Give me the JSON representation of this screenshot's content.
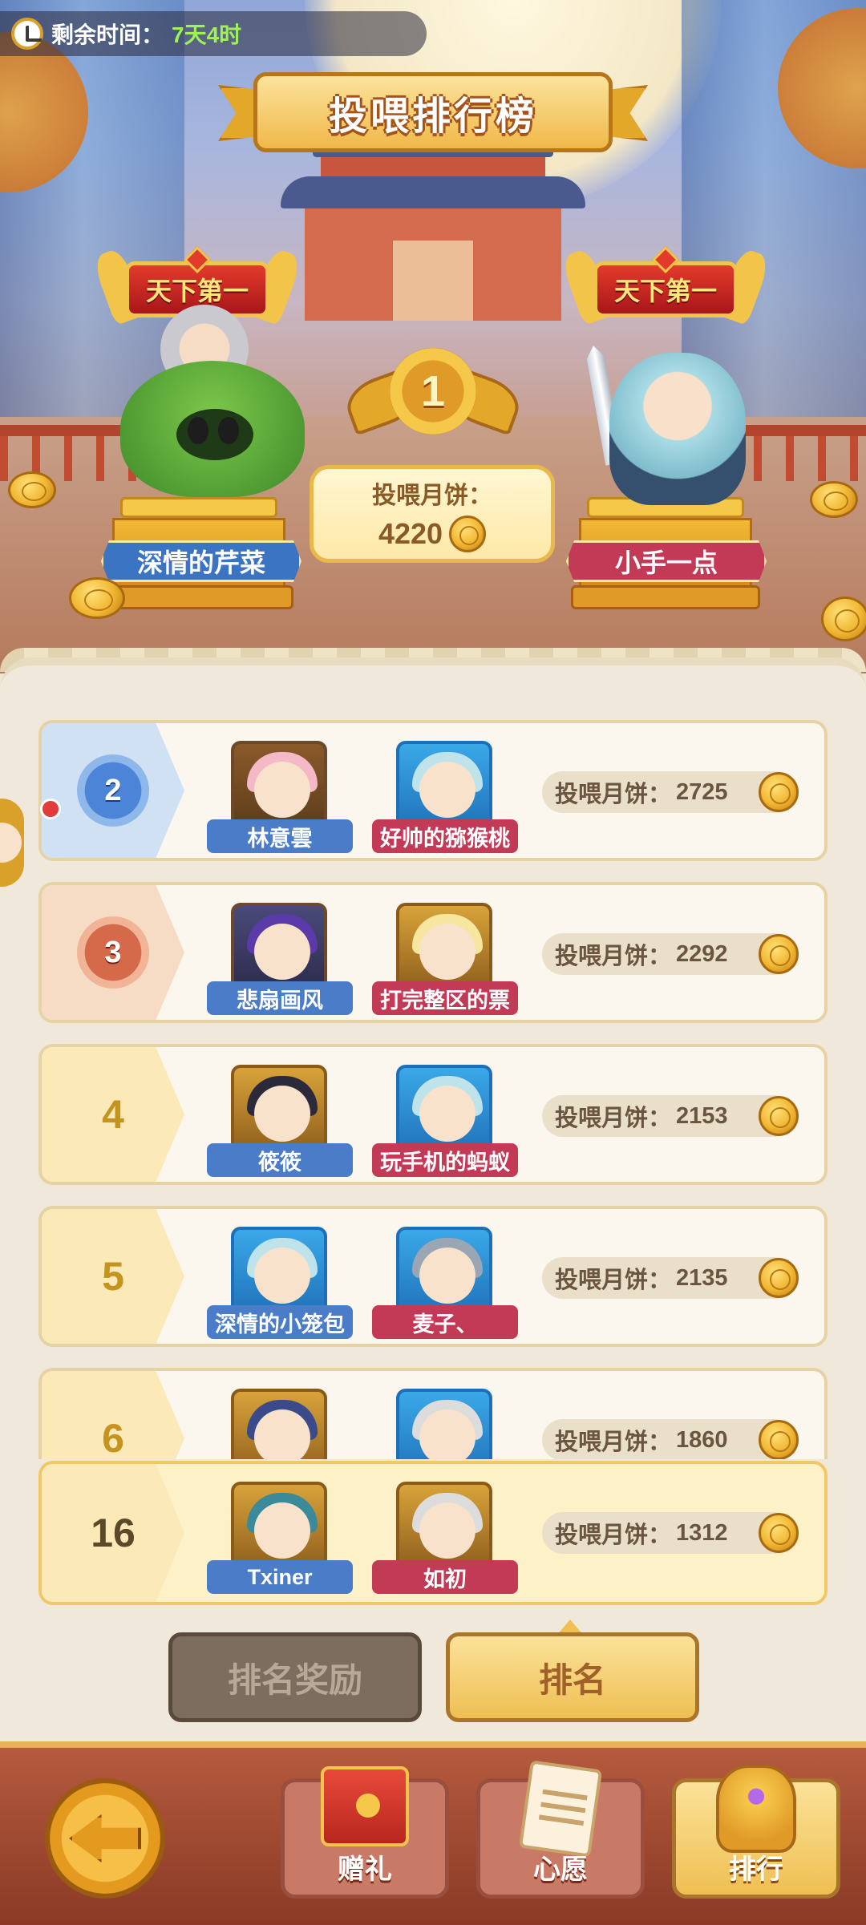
{
  "timer": {
    "label": "剩余时间：",
    "value": "7天4时"
  },
  "title": "投喂排行榜",
  "champions": {
    "badge_left": "天下第一",
    "badge_right": "天下第一",
    "left_name": "深情的芹菜",
    "right_name": "小手一点",
    "first_rank": "1",
    "score_label": "投喂月饼：",
    "score_value": "4220"
  },
  "rows": [
    {
      "rank": "2",
      "medal": "silver",
      "player1": "林意雲",
      "player2": "好帅的猕猴桃",
      "label": "投喂月饼：",
      "value": "2725"
    },
    {
      "rank": "3",
      "medal": "bronze",
      "player1": "悲扇画风",
      "player2": "打完整区的票",
      "label": "投喂月饼：",
      "value": "2292"
    },
    {
      "rank": "4",
      "player1": "筱筱",
      "player2": "玩手机的蚂蚁",
      "label": "投喂月饼：",
      "value": "2153"
    },
    {
      "rank": "5",
      "player1": "深情的小笼包",
      "player2": "麦子、",
      "label": "投喂月饼：",
      "value": "2135"
    },
    {
      "rank": "6",
      "player1": "",
      "player2": "",
      "label": "投喂月饼：",
      "value": "1860"
    }
  ],
  "self_row": {
    "rank": "16",
    "player1": "Txiner",
    "player2": "如初",
    "label": "投喂月饼：",
    "value": "1312"
  },
  "tabs": {
    "reward": "排名奖励",
    "ranking": "排名"
  },
  "nav": {
    "gift": "赠礼",
    "wish": "心愿",
    "rank": "排行"
  },
  "colors": {
    "accent_gold": "#efbf52",
    "blue_tag": "#4a7cc8",
    "red_tag": "#c23a56"
  }
}
